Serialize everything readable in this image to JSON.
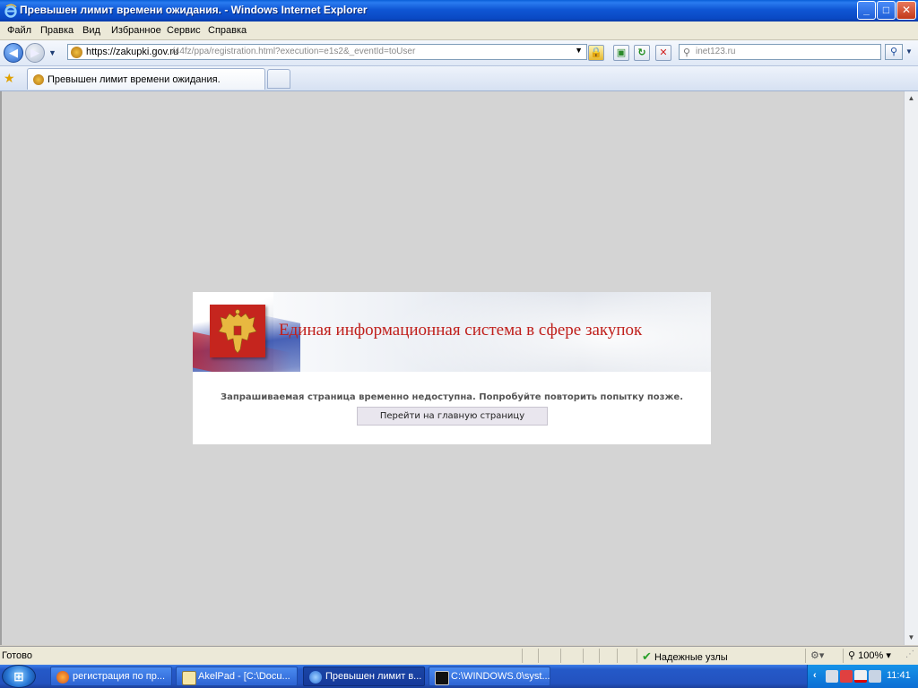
{
  "window": {
    "title": "Превышен лимит времени ожидания. - Windows Internet Explorer"
  },
  "menu": [
    "Файл",
    "Правка",
    "Вид",
    "Избранное",
    "Сервис",
    "Справка"
  ],
  "address": {
    "url_proto": "https://",
    "url_host": "zakupki.gov.ru",
    "url_path": "/44fz/ppa/registration.html?execution=e1s2&_eventId=toUser"
  },
  "search": {
    "placeholder": "inet123.ru"
  },
  "tab": {
    "label": "Превышен лимит времени ожидания."
  },
  "page": {
    "heading": "Единая информационная система в сфере закупок",
    "message": "Запрашиваемая страница временно недоступна. Попробуйте повторить попытку позже.",
    "button": "Перейти на главную страницу"
  },
  "status": {
    "text": "Готово",
    "zone": "Надежные узлы",
    "zoom": "100%"
  },
  "taskbar": {
    "tasks": [
      "регистрация по пр...",
      "AkelPad - [C:\\Docu...",
      "Превышен лимит в...",
      "C:\\WINDOWS.0\\syst..."
    ],
    "clock": "11:41"
  },
  "colors": {
    "heading": "#c0201c",
    "emblem": "#c5251e",
    "page_bg": "#d4d4d4"
  }
}
